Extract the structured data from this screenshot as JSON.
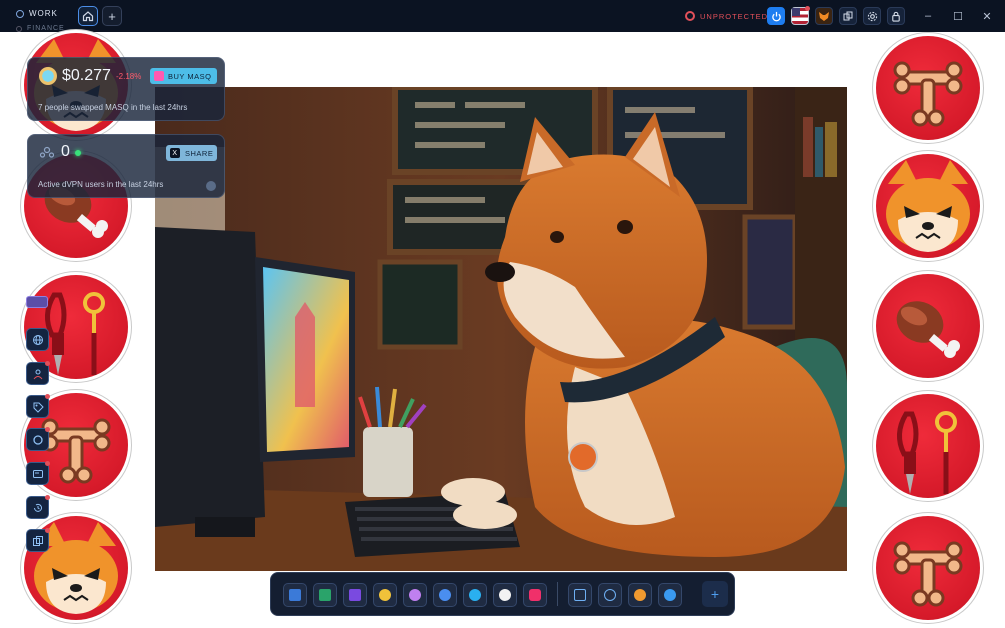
{
  "titlebar": {
    "workspace_active": "WORK",
    "workspace_second": "FINANCE",
    "plus_label": "+",
    "status": "UNPROTECTED",
    "icons": [
      "power-icon",
      "us-flag-icon",
      "fox-wallet-icon",
      "copy-icon",
      "settings-icon",
      "lock-icon"
    ],
    "window_controls": [
      "minimize",
      "maximize",
      "close"
    ],
    "min_glyph": "–",
    "max_glyph": "☐",
    "close_glyph": "✕"
  },
  "token_widget": {
    "price": "$0.277",
    "change": "-2.18%",
    "buy_label": "BUY MASQ",
    "subtitle": "7 people swapped MASQ in the last 24hrs"
  },
  "dvpn_widget": {
    "count": "0",
    "share_label": "SHARE",
    "share_icon": "X",
    "subtitle": "Active dVPN users in the last 24hrs"
  },
  "left_toolbar": {
    "items": [
      "globe-icon",
      "user-icon",
      "tag-icon",
      "circle-icon",
      "wallet-icon",
      "history-icon",
      "copy-files-icon"
    ]
  },
  "dock": {
    "apps": [
      "browser",
      "chart-app",
      "opensea",
      "coin",
      "lotus",
      "ens",
      "blue-app",
      "panda",
      "red-app"
    ],
    "pinned": [
      "folder",
      "app-store",
      "orange-app",
      "blue-diamond"
    ],
    "add_label": "+"
  },
  "stickers": {
    "left": [
      "shiba-face",
      "meat",
      "leash",
      "bone",
      "shiba-face"
    ],
    "right": [
      "bone",
      "shiba-face",
      "meat",
      "leash",
      "bone"
    ]
  },
  "colors": {
    "titlebar_bg": "#0b1322",
    "accent_blue": "#1e7df0",
    "sticker_red": "#d61a2a",
    "alert_red": "#e2505a"
  }
}
